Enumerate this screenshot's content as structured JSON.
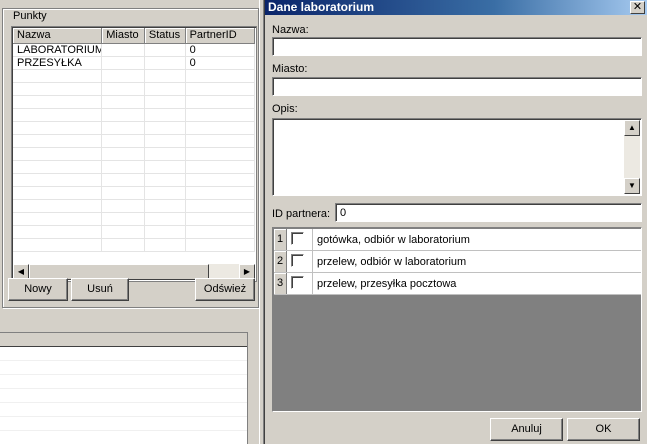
{
  "left_panel": {
    "group_title": "Punkty",
    "columns": [
      "Nazwa",
      "Miasto",
      "Status",
      "PartnerID"
    ],
    "rows": [
      [
        "LABORATORIUM",
        "",
        "",
        "0"
      ],
      [
        "PRZESYŁKA",
        "",
        "",
        "0"
      ]
    ],
    "empty_rows": 14,
    "buttons": {
      "new": "Nowy",
      "delete": "Usuń",
      "refresh": "Odśwież"
    }
  },
  "dialog": {
    "title": "Dane laboratorium",
    "close_glyph": "✕",
    "name_label": "Nazwa:",
    "name_value": "",
    "city_label": "Miasto:",
    "city_value": "",
    "desc_label": "Opis:",
    "desc_value": "",
    "partner_label": "ID partnera:",
    "partner_value": "0",
    "options": [
      {
        "num": "1",
        "label": "gotówka, odbiór w laboratorium",
        "checked": false
      },
      {
        "num": "2",
        "label": "przelew, odbiór w laboratorium",
        "checked": false
      },
      {
        "num": "3",
        "label": "przelew, przesyłka pocztowa",
        "checked": false
      }
    ],
    "cancel_label": "Anuluj",
    "ok_label": "OK"
  },
  "icons": {
    "scroll_left": "◀",
    "scroll_right": "▶",
    "scroll_up": "▲",
    "scroll_down": "▼"
  }
}
